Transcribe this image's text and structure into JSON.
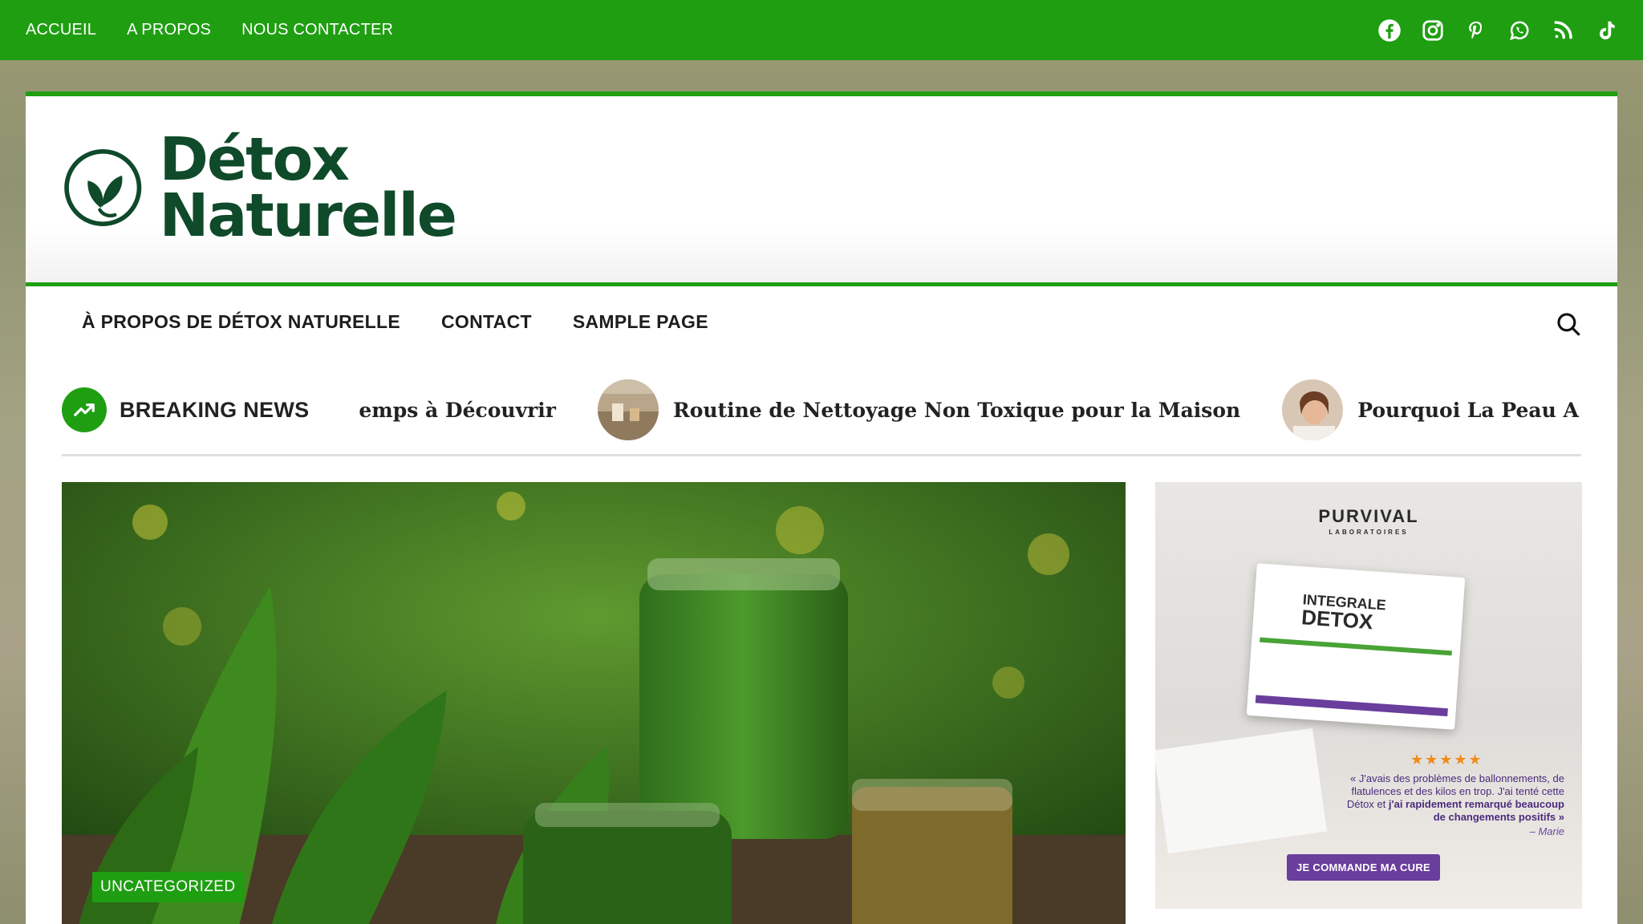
{
  "topbar": {
    "nav": [
      "ACCUEIL",
      "A PROPOS",
      "NOUS CONTACTER"
    ],
    "social_icons": [
      "facebook-icon",
      "instagram-icon",
      "pinterest-icon",
      "whatsapp-icon",
      "rss-icon",
      "tiktok-icon"
    ],
    "bg_color": "#1f9e12"
  },
  "logo": {
    "line1": "Détox",
    "line2": "Naturelle",
    "color": "#0f4a2a"
  },
  "mainnav": {
    "items": [
      "À PROPOS DE DÉTOX NATURELLE",
      "CONTACT",
      "SAMPLE PAGE"
    ]
  },
  "breaking": {
    "label": "BREAKING NEWS",
    "items": [
      {
        "title": "emps à Découvrir"
      },
      {
        "title": "Routine de Nettoyage Non Toxique pour la Maison"
      },
      {
        "title": "Pourquoi La Peau A Besoin De Dé"
      }
    ]
  },
  "featured": {
    "category": "UNCATEGORIZED"
  },
  "ad": {
    "brand": "PURVIVAL",
    "brand_sub": "LABORATOIRES",
    "product_line1": "INTEGRALE",
    "product_line2": "DETOX",
    "stars": "★★★★★",
    "quote_part1": "« J'avais des problèmes de ballonnements, de flatulences et des kilos en trop. J'ai tenté cette Détox et",
    "quote_bold": "j'ai rapidement remarqué beaucoup de changements positifs »",
    "signature": "– Marie",
    "cta": "JE COMMANDE MA CURE",
    "accent": "#6a3e9c"
  }
}
